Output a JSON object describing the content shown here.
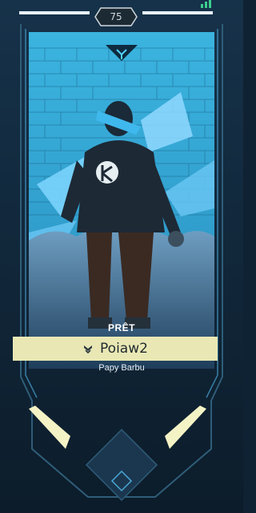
{
  "header": {
    "level": "75",
    "signal_icon": "signal-strength-icon"
  },
  "player_card": {
    "status": "PRÊT",
    "name": "Poiaw2",
    "title": "Papy Barbu",
    "rank_icon": "rank-chevron-icon",
    "emblem_icon": "team-emblem-icon"
  },
  "colors": {
    "accent_cyan": "#2aa6e0",
    "banner_bg": "#e9e8b4",
    "frame_dark": "#0f2233",
    "glow_yellow": "#f4f3c6"
  }
}
